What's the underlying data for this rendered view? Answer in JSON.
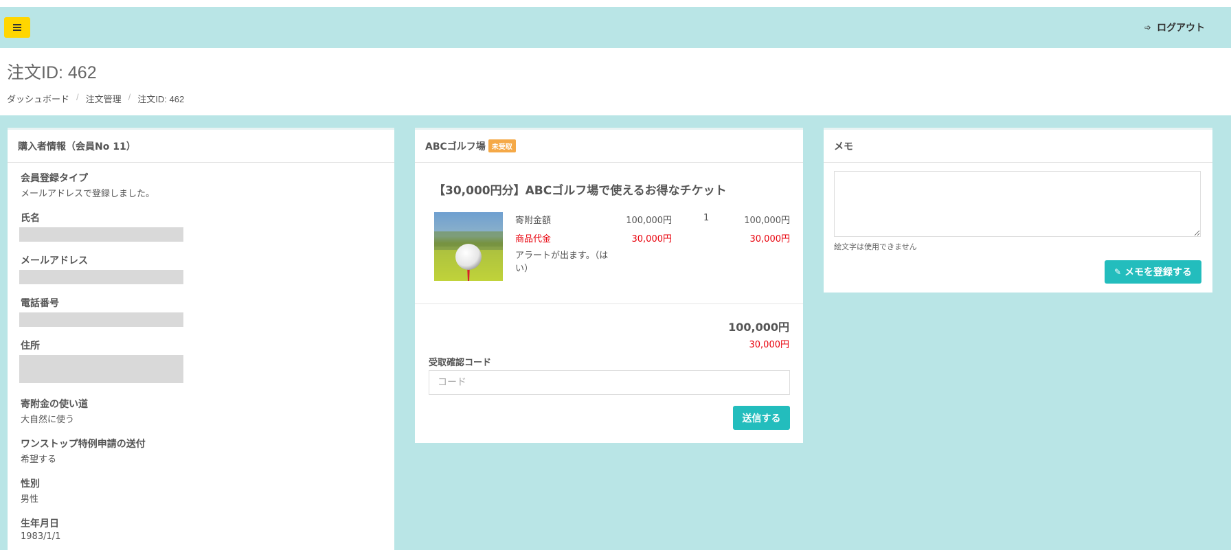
{
  "header": {
    "menu_icon": "hamburger-icon",
    "logout_icon": "sign-out-icon",
    "logout_label": "ログアウト"
  },
  "page": {
    "title": "注文ID: 462",
    "breadcrumb": [
      "ダッシュボード",
      "注文管理",
      "注文ID: 462"
    ]
  },
  "buyer": {
    "heading": "購入者情報（会員No 11）",
    "fields": [
      {
        "label": "会員登録タイプ",
        "value": "メールアドレスで登録しました。"
      },
      {
        "label": "氏名",
        "value": null
      },
      {
        "label": "メールアドレス",
        "value": null
      },
      {
        "label": "電話番号",
        "value": null
      },
      {
        "label": "住所",
        "value": null
      },
      {
        "label": "寄附金の使い道",
        "value": "大自然に使う"
      },
      {
        "label": "ワンストップ特例申請の送付",
        "value": "希望する"
      },
      {
        "label": "性別",
        "value": "男性"
      },
      {
        "label": "生年月日",
        "value": "1983/1/1"
      }
    ]
  },
  "ticket": {
    "shop": "ABCゴルフ場",
    "status_badge": "未受取",
    "title": "【30,000円分】ABCゴルフ場で使えるお得なチケット",
    "image_icon": "golf-ball-image",
    "rows": [
      {
        "label": "寄附金額",
        "price": "100,000円",
        "qty": "1",
        "subtotal": "100,000円"
      },
      {
        "label": "商品代金",
        "price": "30,000円",
        "qty": "",
        "subtotal": "30,000円"
      }
    ],
    "alert_text": "アラートが出ます。（はい）",
    "total": "100,000円",
    "total_sub": "30,000円",
    "code_label": "受取確認コード",
    "code_placeholder": "コード",
    "submit_label": "送信する",
    "accent_color": "#e8000b"
  },
  "memo": {
    "heading": "メモ",
    "help": "絵文字は使用できません",
    "save_icon": "pencil-icon",
    "save_label": "メモを登録する"
  },
  "colors": {
    "background": "#b9e5e6",
    "menu_button": "#ffd600",
    "button": "#23bdbd",
    "badge": "#f5a947"
  }
}
